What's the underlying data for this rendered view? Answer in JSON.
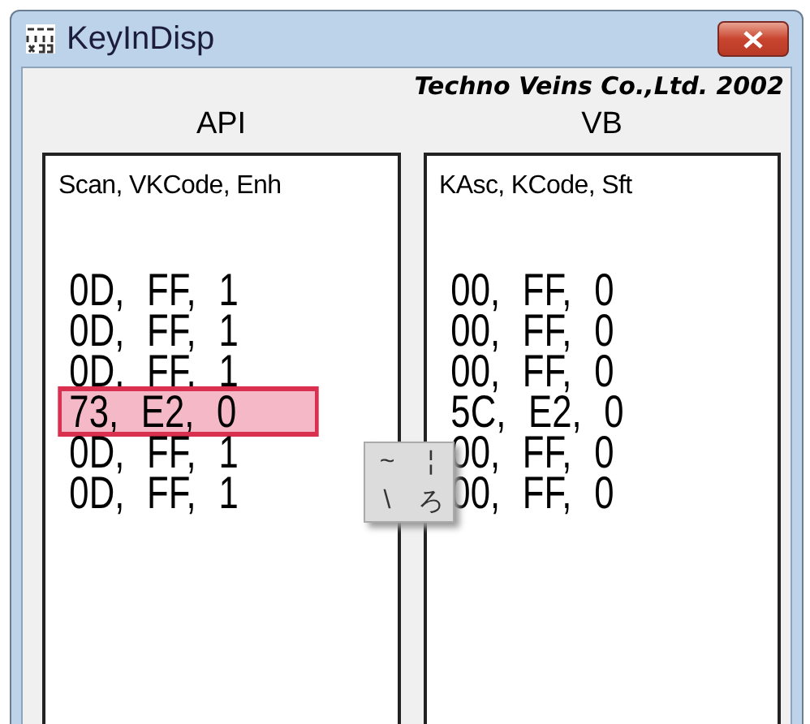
{
  "window": {
    "title": "KeyInDisp"
  },
  "credit": "Techno Veins Co.,Ltd. 2002",
  "panels": [
    {
      "title": "API",
      "header": "Scan, VKCode, Enh",
      "rows": [
        {
          "text": "0D, FF, 1",
          "highlighted": false
        },
        {
          "text": "0D, FF, 1",
          "highlighted": false
        },
        {
          "text": "0D, FF, 1",
          "highlighted": false
        },
        {
          "text": "73, E2, 0",
          "highlighted": true
        },
        {
          "text": "0D, FF, 1",
          "highlighted": false
        },
        {
          "text": "0D, FF, 1",
          "highlighted": false
        }
      ]
    },
    {
      "title": "VB",
      "header": "KAsc, KCode, Sft",
      "rows": [
        {
          "text": "00, FF, 0",
          "highlighted": false
        },
        {
          "text": "00, FF, 0",
          "highlighted": false
        },
        {
          "text": "00, FF, 0",
          "highlighted": false
        },
        {
          "text": "5C, E2, 0",
          "highlighted": false
        },
        {
          "text": "00, FF, 0",
          "highlighted": false
        },
        {
          "text": "00, FF, 0",
          "highlighted": false
        }
      ]
    }
  ],
  "keycap": {
    "top_left": "~",
    "top_right": "¦",
    "bottom_left": "\\",
    "bottom_right": "ろ"
  }
}
